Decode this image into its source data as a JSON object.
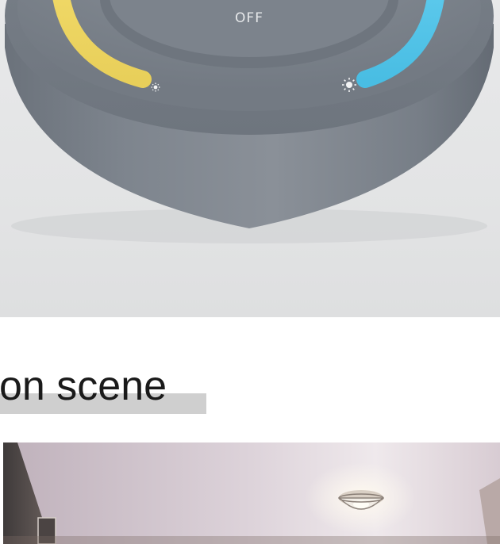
{
  "product": {
    "off_label": "OFF",
    "warm_accent_color": "#ecd35f",
    "cool_accent_color": "#4fc2e6",
    "body_color": "#79808a",
    "icons": [
      "sun-small-icon",
      "sun-large-icon"
    ]
  },
  "heading": {
    "text": "on scene"
  },
  "photo": {
    "subject": "ceiling-light-icon"
  }
}
